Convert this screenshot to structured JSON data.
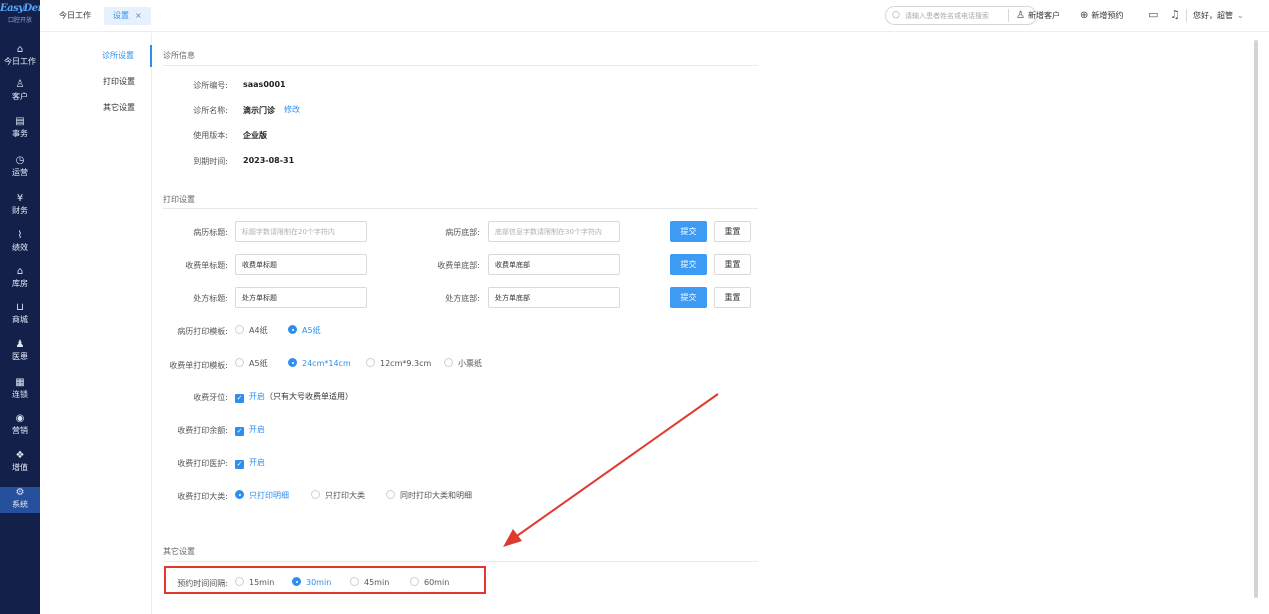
{
  "brand": {
    "name": "EasyDent",
    "subtitle": "口腔开放"
  },
  "nav": [
    {
      "label": "今日工作",
      "icon": "home-icon",
      "glyph": "⌂"
    },
    {
      "label": "客户",
      "icon": "user-icon",
      "glyph": "♙"
    },
    {
      "label": "事务",
      "icon": "task-icon",
      "glyph": "▤"
    },
    {
      "label": "运营",
      "icon": "clock-icon",
      "glyph": "◷"
    },
    {
      "label": "财务",
      "icon": "finance-icon",
      "glyph": "¥"
    },
    {
      "label": "绩效",
      "icon": "chart-icon",
      "glyph": "⌇"
    },
    {
      "label": "库房",
      "icon": "warehouse-icon",
      "glyph": "⌂"
    },
    {
      "label": "商城",
      "icon": "cart-icon",
      "glyph": "⊔"
    },
    {
      "label": "医患",
      "icon": "people-icon",
      "glyph": "♟"
    },
    {
      "label": "连锁",
      "icon": "building-icon",
      "glyph": "▦"
    },
    {
      "label": "营销",
      "icon": "target-icon",
      "glyph": "◉"
    },
    {
      "label": "增值",
      "icon": "value-icon",
      "glyph": "❖"
    },
    {
      "label": "系统",
      "icon": "gear-icon",
      "glyph": "⚙"
    }
  ],
  "tabs": {
    "home": "今日工作",
    "settings": "设置",
    "close": "×"
  },
  "search": {
    "placeholder": "请输入患者姓名或电话搜索"
  },
  "top": {
    "new_customer": "新增客户",
    "new_appointment": "新增预约",
    "greeting": "您好，超管"
  },
  "submenu": [
    "诊所设置",
    "打印设置",
    "其它设置"
  ],
  "clinic": {
    "title": "诊所信息",
    "code_label": "诊所编号:",
    "code": "saas0001",
    "name_label": "诊所名称:",
    "name": "滴示门诊",
    "edit": "修改",
    "version_label": "使用版本:",
    "version": "企业版",
    "expire_label": "到期时间:",
    "expire": "2023-08-31"
  },
  "print": {
    "title": "打印设置",
    "submit": "提交",
    "reset": "重置",
    "rows": [
      {
        "left_label": "病历标题:",
        "left_value": "",
        "left_placeholder": "标题字数请限制在20个字符内",
        "right_label": "病历底部:",
        "right_value": "",
        "right_placeholder": "底部信息字数请限制在30个字符内"
      },
      {
        "left_label": "收费单标题:",
        "left_value": "收费单标题",
        "left_placeholder": "",
        "right_label": "收费单底部:",
        "right_value": "收费单底部",
        "right_placeholder": ""
      },
      {
        "left_label": "处方标题:",
        "left_value": "处方单标题",
        "left_placeholder": "",
        "right_label": "处方底部:",
        "right_value": "处方单底部",
        "right_placeholder": ""
      }
    ],
    "record_template": {
      "label": "病历打印模板:",
      "options": [
        "A4纸",
        "A5纸"
      ],
      "selected": 1
    },
    "receipt_template": {
      "label": "收费单打印模板:",
      "options": [
        "A5纸",
        "24cm*14cm",
        "12cm*9.3cm",
        "小票纸"
      ],
      "selected": 1
    },
    "tooth": {
      "label": "收费牙位:",
      "on": "开启",
      "note": "（只有大号收费单适用）"
    },
    "balance": {
      "label": "收费打印余额:",
      "on": "开启"
    },
    "nurse": {
      "label": "收费打印医护:",
      "on": "开启"
    },
    "category": {
      "label": "收费打印大类:",
      "options": [
        "只打印明细",
        "只打印大类",
        "同时打印大类和明细"
      ],
      "selected": 0
    }
  },
  "other": {
    "title": "其它设置",
    "interval": {
      "label": "预约时间间隔:",
      "options": [
        "15min",
        "30min",
        "45min",
        "60min"
      ],
      "selected": 1
    }
  },
  "colors": {
    "accent": "#2f8ff0",
    "nav_bg": "#12204a",
    "annotation": "#e03a2f"
  }
}
